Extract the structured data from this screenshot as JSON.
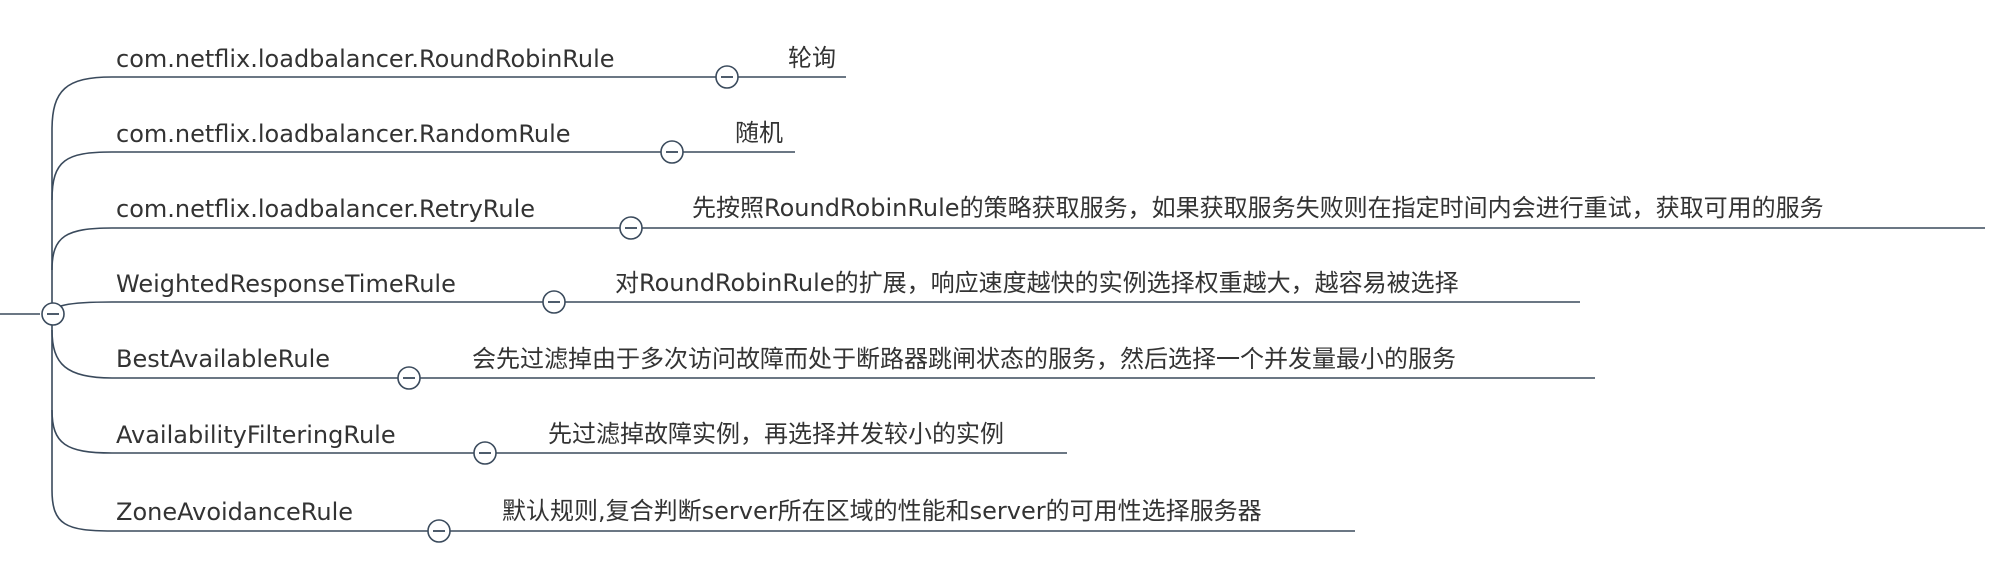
{
  "root": {
    "collapse_symbol": "minus",
    "colors": {
      "line": "#3a4a5c",
      "text": "#333333",
      "background": "#ffffff"
    }
  },
  "nodes": [
    {
      "label": "com.netflix.loadbalancer.RoundRobinRule",
      "description": "轮询"
    },
    {
      "label": "com.netflix.loadbalancer.RandomRule",
      "description": "随机"
    },
    {
      "label": "com.netflix.loadbalancer.RetryRule",
      "description": "先按照RoundRobinRule的策略获取服务，如果获取服务失败则在指定时间内会进行重试，获取可用的服务"
    },
    {
      "label": "WeightedResponseTimeRule",
      "description": "对RoundRobinRule的扩展，响应速度越快的实例选择权重越大，越容易被选择"
    },
    {
      "label": "BestAvailableRule",
      "description": "会先过滤掉由于多次访问故障而处于断路器跳闸状态的服务，然后选择一个并发量最小的服务"
    },
    {
      "label": "AvailabilityFilteringRule",
      "description": "先过滤掉故障实例，再选择并发较小的实例"
    },
    {
      "label": "ZoneAvoidanceRule",
      "description": "默认规则,复合判断server所在区域的性能和server的可用性选择服务器"
    }
  ]
}
